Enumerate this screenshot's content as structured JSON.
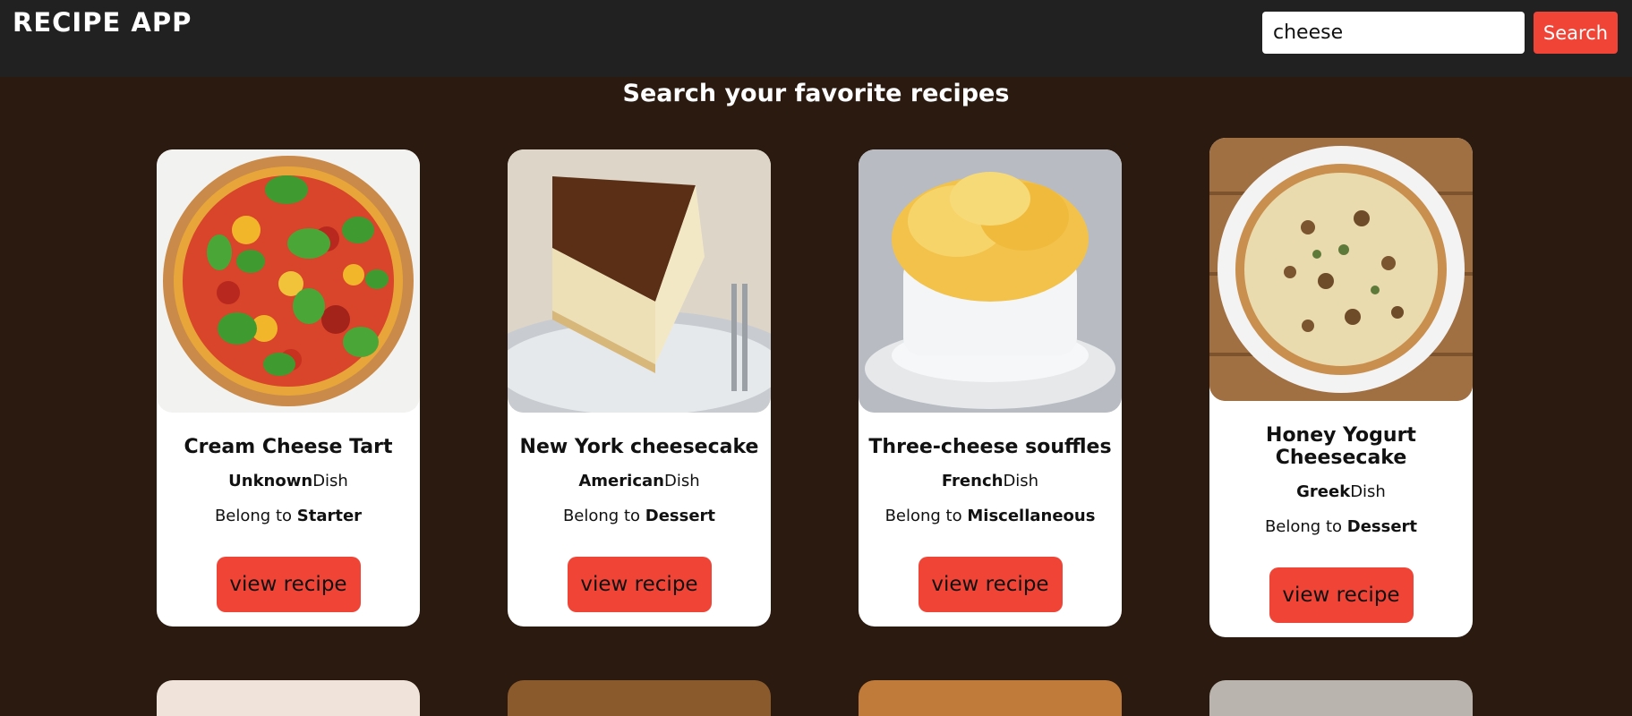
{
  "header": {
    "logo": "RECIPE APP",
    "search_value": "cheese",
    "search_button": "Search"
  },
  "page_title": "Search your favorite recipes",
  "cards": [
    {
      "title": "Cream Cheese Tart",
      "area": "Unknown",
      "area_suffix": "Dish",
      "category_prefix": "Belong to ",
      "category": "Starter",
      "button": "view recipe",
      "image": "tomato-basil-tart"
    },
    {
      "title": "New York cheesecake",
      "area": "American",
      "area_suffix": "Dish",
      "category_prefix": "Belong to ",
      "category": "Dessert",
      "button": "view recipe",
      "image": "cheesecake-slice"
    },
    {
      "title": "Three-cheese souffles",
      "area": "French",
      "area_suffix": "Dish",
      "category_prefix": "Belong to ",
      "category": "Miscellaneous",
      "button": "view recipe",
      "image": "souffle-ramekin"
    },
    {
      "title": "Honey Yogurt Cheesecake",
      "area": "Greek",
      "area_suffix": "Dish",
      "category_prefix": "Belong to ",
      "category": "Dessert",
      "button": "view recipe",
      "image": "mushroom-cheesecake-pie"
    }
  ]
}
